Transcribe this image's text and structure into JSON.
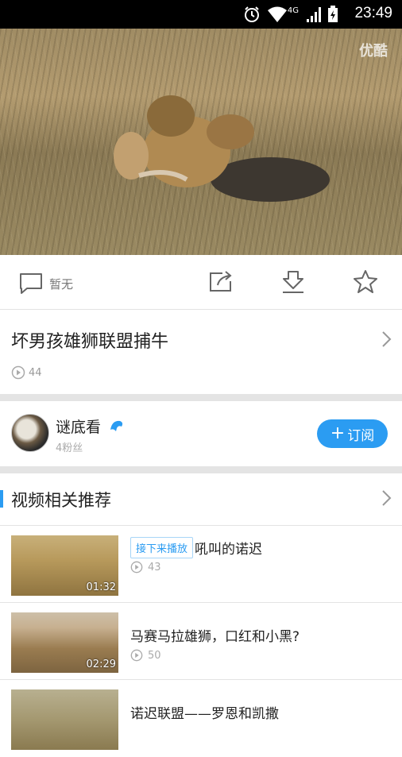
{
  "status_bar": {
    "time": "23:49",
    "network": "4G"
  },
  "player": {
    "watermark": "优酷"
  },
  "actions": {
    "comment_label": "暂无"
  },
  "video": {
    "title": "坏男孩雄狮联盟捕牛",
    "views": "44"
  },
  "channel": {
    "name": "谜底看",
    "fans": "4粉丝",
    "subscribe_label": "订阅"
  },
  "recommend": {
    "header": "视频相关推荐",
    "items": [
      {
        "tag": "接下来播放",
        "title": "吼叫的诺迟",
        "views": "43",
        "duration": "01:32"
      },
      {
        "tag": "",
        "title": "马赛马拉雄狮，口红和小黑?",
        "views": "50",
        "duration": "02:29"
      },
      {
        "tag": "",
        "title": "诺迟联盟——罗恩和凯撒",
        "views": "",
        "duration": ""
      }
    ]
  },
  "colors": {
    "accent": "#2b9cf2",
    "separator": "#e4e4e4",
    "text": "#222222"
  }
}
